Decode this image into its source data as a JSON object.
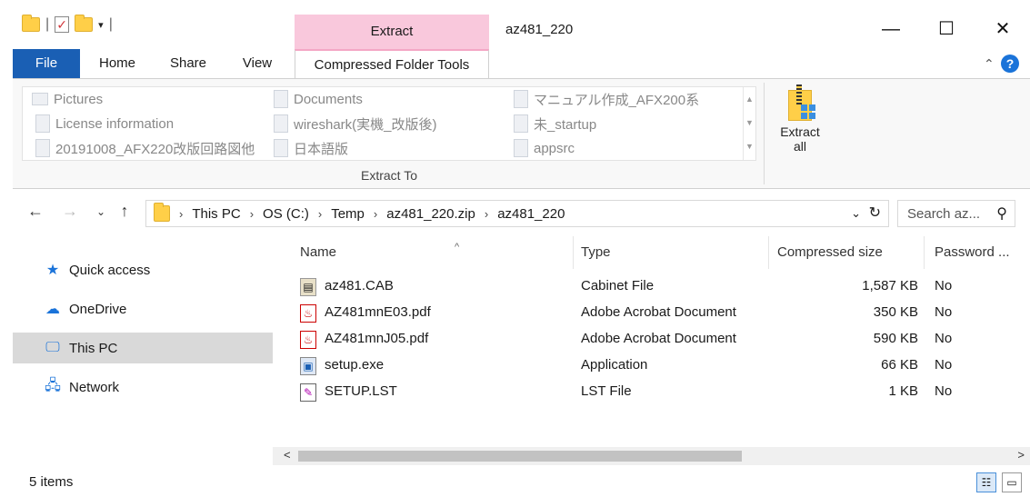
{
  "window": {
    "title": "az481_220",
    "context_tab_group": "Extract",
    "minimize_icon": "minimize-icon",
    "maximize_icon": "maximize-icon",
    "close_icon": "close-icon"
  },
  "ribbon": {
    "tabs": {
      "file": "File",
      "home": "Home",
      "share": "Share",
      "view": "View",
      "compressed": "Compressed Folder Tools"
    },
    "gallery": [
      [
        "Pictures",
        "Documents",
        "マニュアル作成_AFX200系"
      ],
      [
        "License information",
        "wireshark(実機_改版後)",
        "未_startup"
      ],
      [
        "20191008_AFX220改版回路図他",
        "日本語版",
        "appsrc"
      ]
    ],
    "group_label": "Extract To",
    "extract_all": "Extract all",
    "accent": "#f9c8dc"
  },
  "address": {
    "crumbs": [
      "This PC",
      "OS (C:)",
      "Temp",
      "az481_220.zip",
      "az481_220"
    ],
    "search_placeholder": "Search az..."
  },
  "nav": {
    "items": [
      "Quick access",
      "OneDrive",
      "This PC",
      "Network"
    ],
    "selected": "This PC"
  },
  "columns": {
    "name": "Name",
    "type": "Type",
    "size": "Compressed size",
    "password": "Password ..."
  },
  "files": [
    {
      "name": "az481.CAB",
      "type": "Cabinet File",
      "size": "1,587 KB",
      "password": "No",
      "icon": "cabinet-file-icon"
    },
    {
      "name": "AZ481mnE03.pdf",
      "type": "Adobe Acrobat Document",
      "size": "350 KB",
      "password": "No",
      "icon": "pdf-file-icon"
    },
    {
      "name": "AZ481mnJ05.pdf",
      "type": "Adobe Acrobat Document",
      "size": "590 KB",
      "password": "No",
      "icon": "pdf-file-icon"
    },
    {
      "name": "setup.exe",
      "type": "Application",
      "size": "66 KB",
      "password": "No",
      "icon": "application-file-icon"
    },
    {
      "name": "SETUP.LST",
      "type": "LST File",
      "size": "1 KB",
      "password": "No",
      "icon": "lst-file-icon"
    }
  ],
  "status": {
    "count": "5 items"
  }
}
